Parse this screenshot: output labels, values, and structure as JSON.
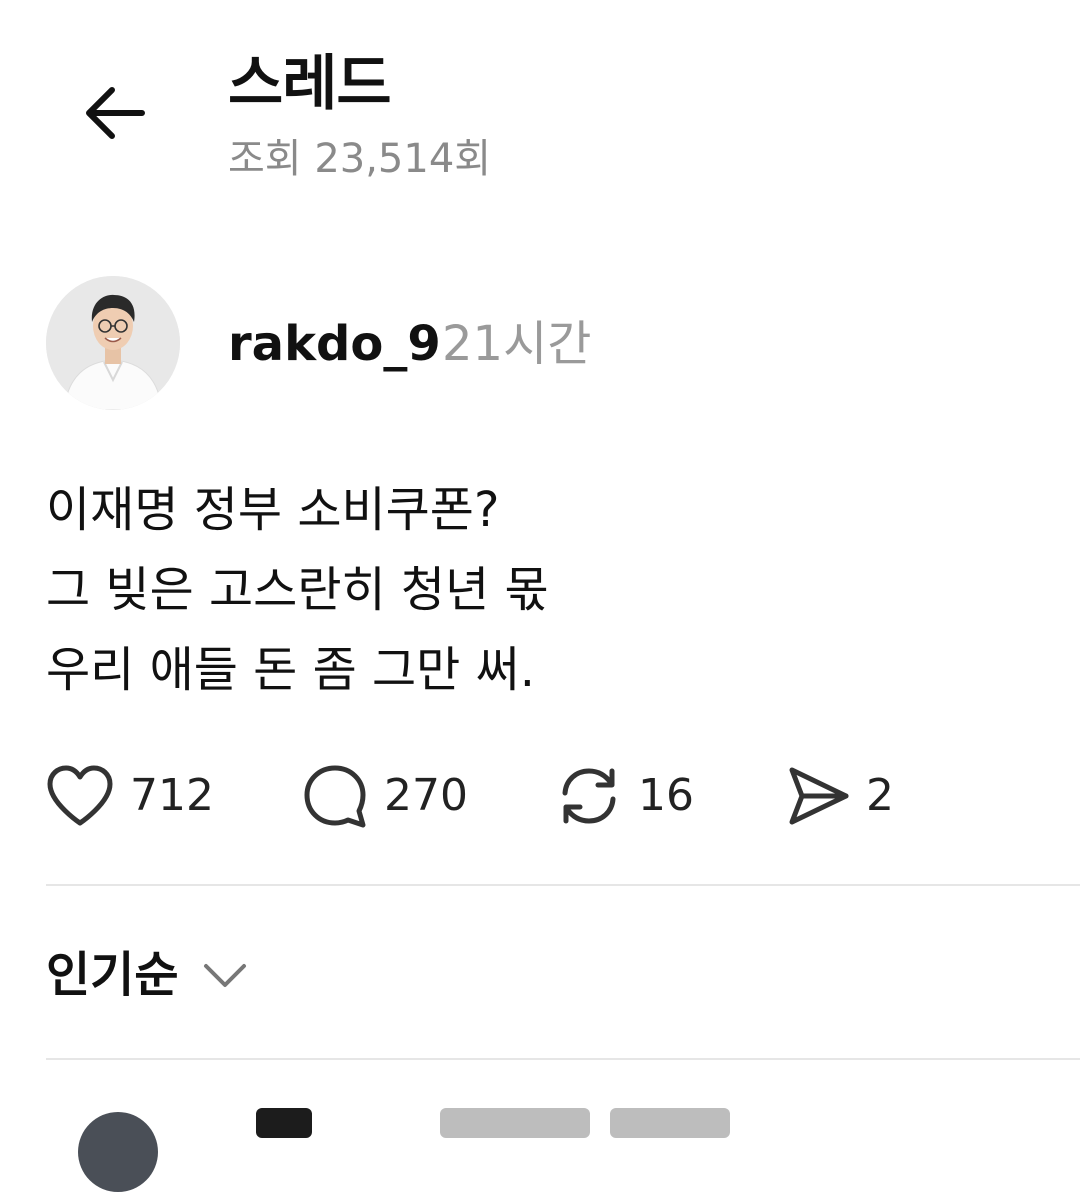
{
  "header": {
    "title": "스레드",
    "views": "조회 23,514회"
  },
  "post": {
    "username": "rakdo_9",
    "time": "21시간",
    "lines": [
      "이재명 정부 소비쿠폰?",
      "그 빚은 고스란히 청년 몫",
      "우리 애들 돈 좀 그만 써."
    ],
    "stats": {
      "likes": "712",
      "comments": "270",
      "reposts": "16",
      "shares": "2"
    },
    "icons": {
      "like": "heart-icon",
      "comment": "comment-bubble-icon",
      "repost": "repost-icon",
      "share": "send-icon"
    }
  },
  "replies": {
    "sort_label": "인기순"
  }
}
